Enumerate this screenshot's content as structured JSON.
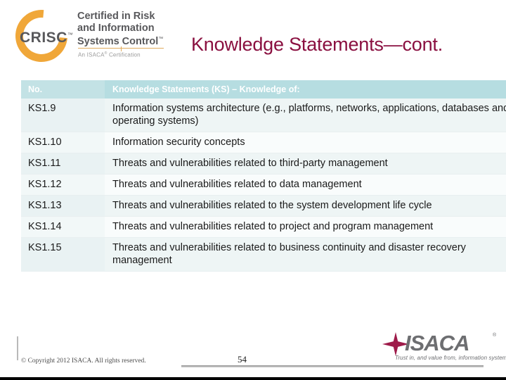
{
  "brand": {
    "crisc_word": "CRISC",
    "crisc_tm": "™",
    "line1": "Certified in Risk",
    "line2": "and Information",
    "line3": "Systems Control",
    "line3_tm": "™",
    "sub": "An ISACA",
    "sub_reg": "®",
    "sub_tail": " Certification",
    "ring_color": "#f0a739",
    "text_color": "#58585b"
  },
  "slide": {
    "title": "Knowledge Statements—cont.",
    "title_color": "#8a1040"
  },
  "table": {
    "header": {
      "no": "No.",
      "ks": "Knowledge Statements (KS) – Knowledge of:"
    },
    "header_bg": "#b6dde1",
    "rows": [
      {
        "no": "KS1.9",
        "ks": "Information systems architecture (e.g., platforms, networks, applications, databases and operating systems)"
      },
      {
        "no": "KS1.10",
        "ks": "Information security concepts"
      },
      {
        "no": "KS1.11",
        "ks": "Threats and vulnerabilities related to third-party management"
      },
      {
        "no": "KS1.12",
        "ks": "Threats and vulnerabilities related to data management"
      },
      {
        "no": "KS1.13",
        "ks": "Threats and vulnerabilities related to the system development life cycle"
      },
      {
        "no": "KS1.14",
        "ks": "Threats and vulnerabilities related to project and program management"
      },
      {
        "no": "KS1.15",
        "ks": "Threats and vulnerabilities related to business continuity and disaster recovery management"
      }
    ]
  },
  "footer": {
    "copyright": "© Copyright 2012 ISACA. All rights reserved.",
    "page_number": "54"
  },
  "isaca": {
    "word": "ISACA",
    "reg": "®",
    "tagline": "Trust in, and value from, information systems",
    "star_color": "#9e1b4a",
    "word_color": "#6d6e71"
  }
}
